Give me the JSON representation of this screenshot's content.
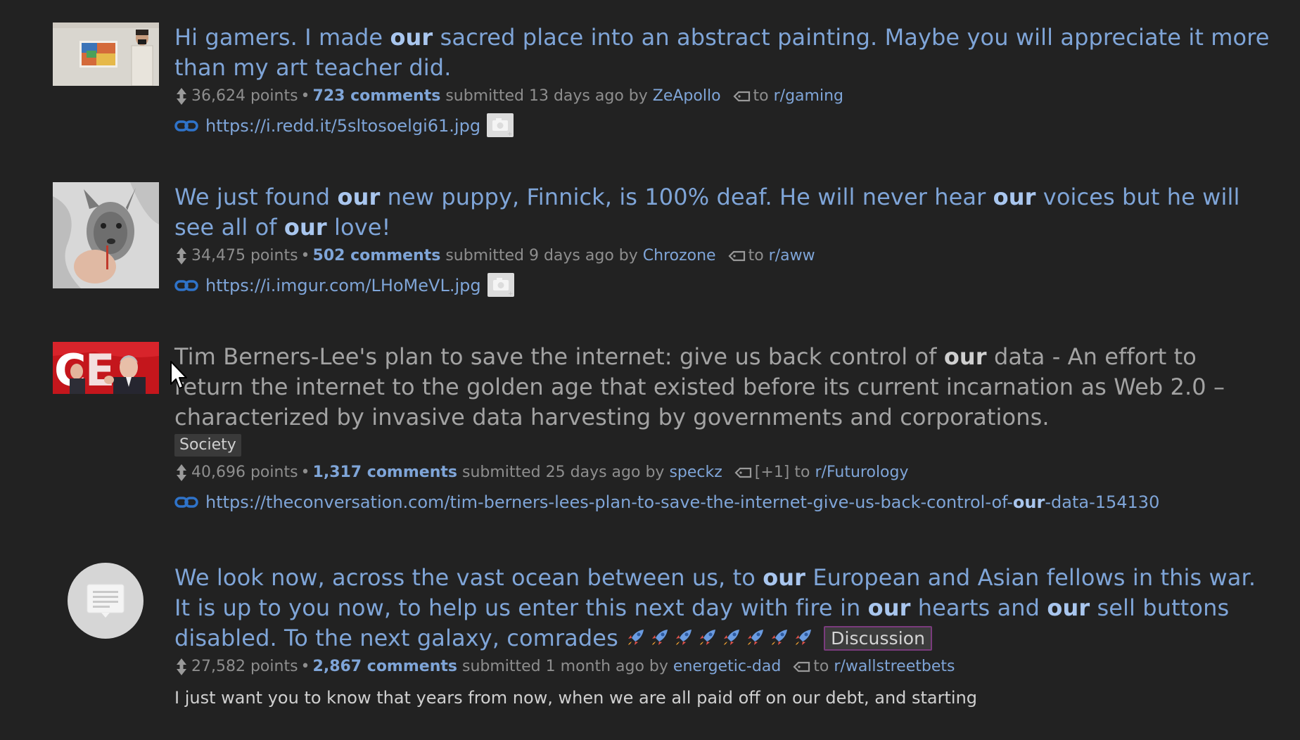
{
  "posts": [
    {
      "title_parts": [
        "Hi gamers. I made ",
        "our",
        " sacred place into an abstract painting. Maybe you will appreciate it more than my art teacher did."
      ],
      "points": "36,624 points",
      "comments": "723 comments",
      "submitted": "submitted 13 days ago by",
      "author": "ZeApollo",
      "to": "to",
      "subreddit": "r/gaming",
      "url": "https://i.redd.it/5sltosoelgi61.jpg",
      "thumb_icon": "painting-photo-thumbnail"
    },
    {
      "title_parts": [
        "We just found ",
        "our",
        " new puppy, Finnick, is 100% deaf. He will never hear ",
        "our",
        " voices but he will see all of ",
        "our",
        " love!"
      ],
      "points": "34,475 points",
      "comments": "502 comments",
      "submitted": "submitted 9 days ago by",
      "author": "Chrozone",
      "to": "to",
      "subreddit": "r/aww",
      "url": "https://i.imgur.com/LHoMeVL.jpg",
      "thumb_icon": "puppy-photo-thumbnail"
    },
    {
      "title_parts": [
        "Tim Berners-Lee's plan to save the internet: give us back control of ",
        "our",
        " data - An effort to return the internet to the golden age that existed before its current incarnation as Web 2.0 – characterized by invasive data harvesting by governments and corporations."
      ],
      "flair": "Society",
      "points": "40,696 points",
      "comments": "1,317 comments",
      "submitted": "submitted 25 days ago by",
      "author": "speckz",
      "crosspost": "[+1]",
      "to": "to",
      "subreddit": "r/Futurology",
      "url_parts": [
        "https://theconversation.com/tim-berners-lees-plan-to-save-the-internet-give-us-back-control-of-",
        "our",
        "-data-154130"
      ],
      "thumb_icon": "speaker-photo-thumbnail"
    },
    {
      "title_parts": [
        "We look now, across the vast ocean between us, to ",
        "our",
        " European and Asian fellows in this war. It is up to you now, to help us enter this next day with fire in ",
        "our",
        " hearts and ",
        "our",
        " sell buttons disabled. To the next galaxy, comrades "
      ],
      "flair": "Discussion",
      "points": "27,582 points",
      "comments": "2,867 comments",
      "submitted": "submitted 1 month ago by",
      "author": "energetic-dad",
      "to": "to",
      "subreddit": "r/wallstreetbets",
      "excerpt": "I just want you to know that years from now, when we are all paid off on our debt, and starting",
      "thumb_icon": "self-text-icon"
    }
  ],
  "colors": {
    "background": "#222222",
    "link": "#7fa5d8",
    "visited": "#a3a3a3",
    "meta": "#8e8e8e",
    "discussion_border": "#7a3b7d"
  }
}
